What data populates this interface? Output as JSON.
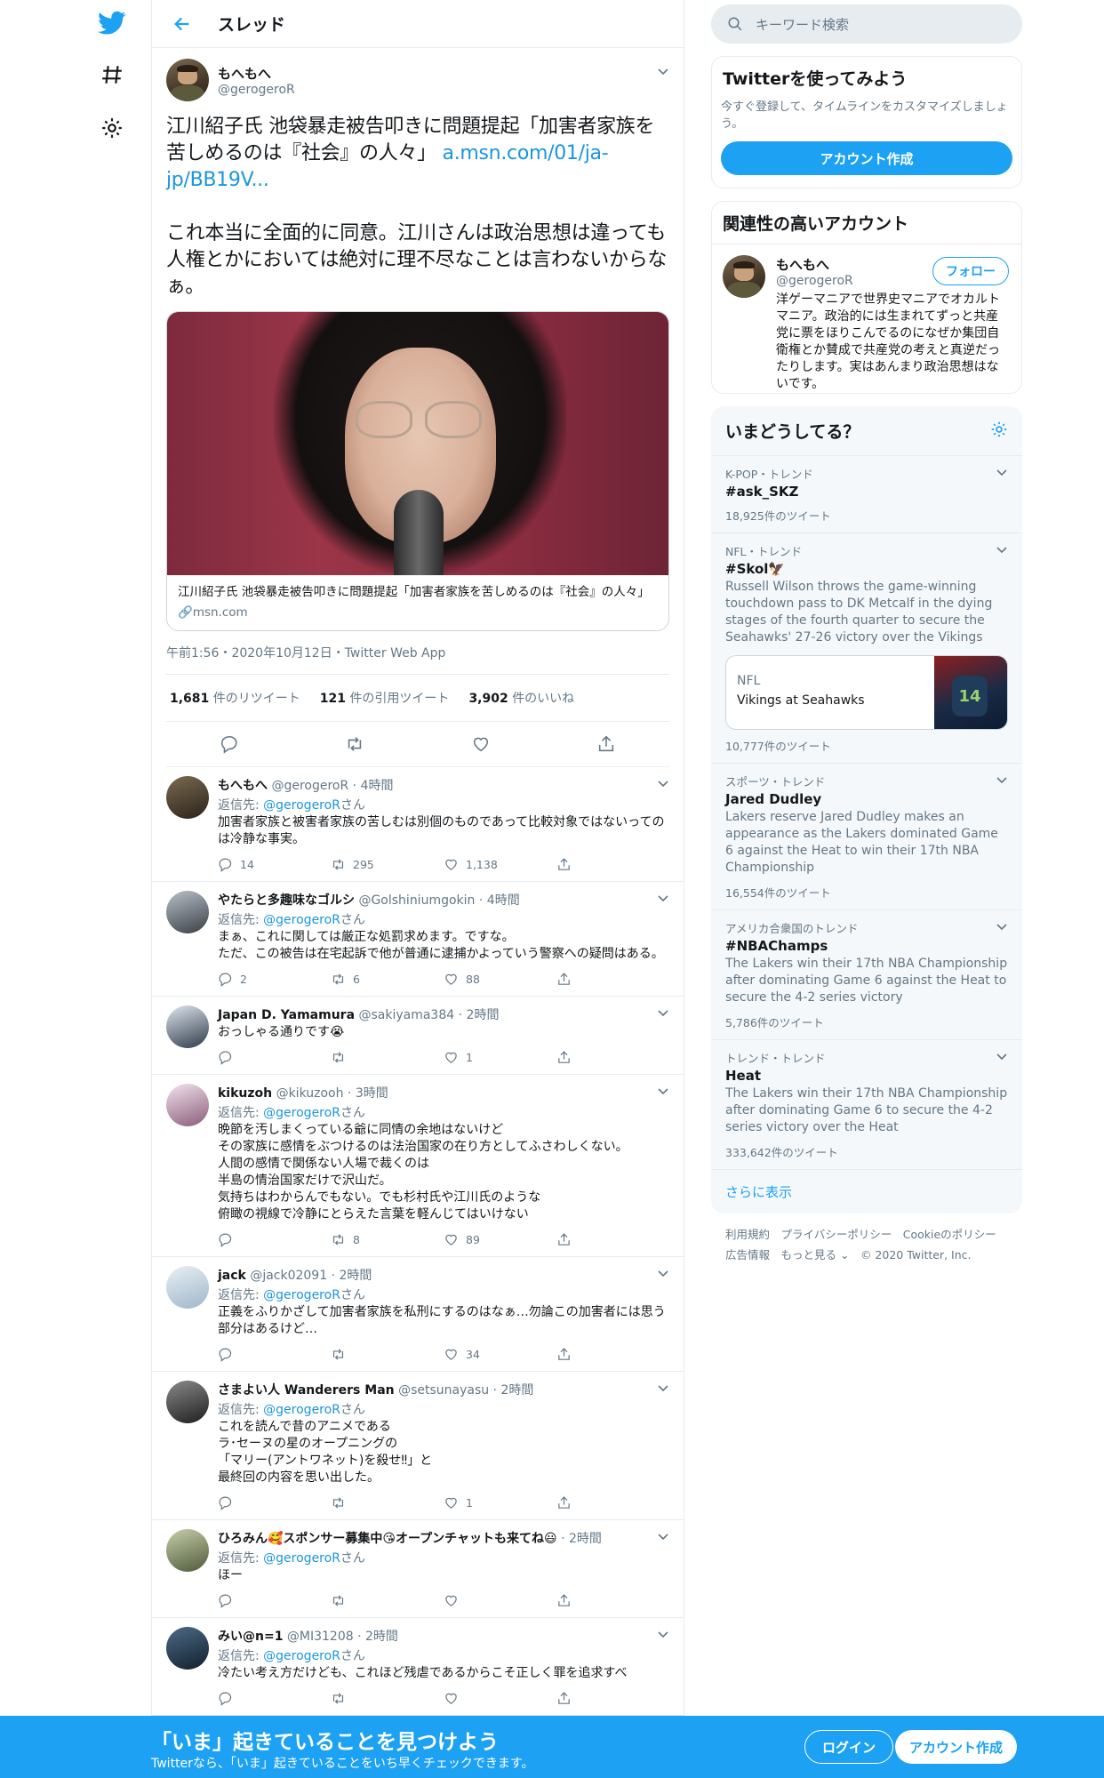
{
  "header": {
    "title": "スレッド"
  },
  "main_tweet": {
    "name": "もへもへ",
    "handle": "@gerogeroR",
    "text": "江川紹子氏 池袋暴走被告叩きに問題提起「加害者家族を苦しめるのは『社会』の人々」",
    "link": "a.msn.com/01/ja-jp/BB19V...",
    "text2": "これ本当に全面的に同意。江川さんは政治思想は違っても人権とかにおいては絶対に理不尽なことは言わないからなぁ。",
    "card_title": "江川紹子氏 池袋暴走被告叩きに問題提起「加害者家族を苦しめるのは『社会』の人々」",
    "card_source": "msn.com",
    "meta": "午前1:56・2020年10月12日・Twitter Web App",
    "retweets": "1,681",
    "retweets_label": "件のリツイート",
    "quotes": "121",
    "quotes_label": "件の引用ツイート",
    "likes": "3,902",
    "likes_label": "件のいいね"
  },
  "replies": [
    {
      "name": "もへもへ",
      "handle": "@gerogeroR",
      "time": "4時間",
      "to": "@gerogeroR",
      "text": "加害者家族と被害者家族の苦しむは別個のものであって比較対象ではないってのは冷静な事実。",
      "reply": "14",
      "rt": "295",
      "like": "1,138",
      "has_to": true
    },
    {
      "name": "やたらと多趣味なゴルシ",
      "handle": "@Golshiniumgokin",
      "time": "4時間",
      "to": "@gerogeroR",
      "text": "まぁ、これに関しては厳正な処罰求めます。ですな。\nただ、この被告は在宅起訴で他が普通に逮捕かよっていう警察への疑問はある。",
      "reply": "2",
      "rt": "6",
      "like": "88",
      "has_to": true
    },
    {
      "name": "Japan D. Yamamura",
      "handle": "@sakiyama384",
      "time": "2時間",
      "to": "",
      "text": "おっしゃる通りです😭",
      "reply": "",
      "rt": "",
      "like": "1",
      "has_to": false
    },
    {
      "name": "kikuzoh",
      "handle": "@kikuzooh",
      "time": "3時間",
      "to": "@gerogeroR",
      "text": "晩節を汚しまくっている爺に同情の余地はないけど\nその家族に感情をぶつけるのは法治国家の在り方としてふさわしくない。\n人間の感情で関係ない人場で裁くのは\n半島の情治国家だけで沢山だ。\n気持ちはわからんでもない。でも杉村氏や江川氏のような\n俯瞰の視線で冷静にとらえた言葉を軽んじてはいけない",
      "reply": "",
      "rt": "8",
      "like": "89",
      "has_to": true
    },
    {
      "name": "jack",
      "handle": "@jack02091",
      "time": "2時間",
      "to": "@gerogeroR",
      "text": "正義をふりかざして加害者家族を私刑にするのはなぁ…勿論この加害者には思う部分はあるけど…",
      "reply": "",
      "rt": "",
      "like": "34",
      "has_to": true
    },
    {
      "name": "さまよい人 Wanderers Man",
      "handle": "@setsunayasu",
      "time": "2時間",
      "to": "@gerogeroR",
      "text": "これを読んで昔のアニメである\nラ･セーヌの星のオープニングの\n「マリー(アントワネット)を殺せ‼」と\n最終回の内容を思い出した。",
      "reply": "",
      "rt": "",
      "like": "1",
      "has_to": true
    },
    {
      "name": "ひろみん🥰スポンサー募集中😘オープンチャットも来てね😃",
      "handle": "",
      "time": "2時間",
      "to": "@gerogeroR",
      "text": "ほー",
      "reply": "",
      "rt": "",
      "like": "",
      "has_to": true
    },
    {
      "name": "みい@n=1",
      "handle": "@MI31208",
      "time": "2時間",
      "to": "@gerogeroR",
      "text": "冷たい考え方だけども、これほど残虐であるからこそ正しく罪を追求すべ",
      "reply": "",
      "rt": "",
      "like": "",
      "has_to": true
    }
  ],
  "reply_to_label": "返信先:",
  "reply_to_suffix": "さん",
  "sidebar": {
    "search_placeholder": "キーワード検索",
    "signup_title": "Twitterを使ってみよう",
    "signup_desc": "今すぐ登録して、タイムラインをカスタマイズしましょう。",
    "signup_button": "アカウント作成",
    "related_title": "関連性の高いアカウント",
    "related_name": "もへもへ",
    "related_handle": "@gerogeroR",
    "follow": "フォロー",
    "related_bio": "洋ゲーマニアで世界史マニアでオカルトマニア。政治的には生まれてずっと共産党に票をほりこんでるのになぜか集団自衛権とか賛成で共産党の考えと真逆だったりします。実はあんまり政治思想はないです。",
    "trends_title": "いまどうしてる？",
    "trends": [
      {
        "cat": "K-POP・トレンド",
        "name": "#ask_SKZ",
        "desc": "",
        "count": "18,925件のツイート"
      },
      {
        "cat": "NFL・トレンド",
        "name": "#Skol🦅",
        "desc": "Russell Wilson throws the game-winning touchdown pass to DK Metcalf in the dying stages of the fourth quarter to secure the Seahawks' 27-26 victory over the Vikings",
        "count": "10,777件のツイート"
      },
      {
        "cat": "スポーツ・トレンド",
        "name": "Jared Dudley",
        "desc": "Lakers reserve Jared Dudley makes an appearance as the Lakers dominated Game 6 against the Heat to win their 17th NBA Championship",
        "count": "16,554件のツイート"
      },
      {
        "cat": "アメリカ合衆国のトレンド",
        "name": "#NBAChamps",
        "desc": "The Lakers win their 17th NBA Championship after dominating Game 6 against the Heat to secure the 4-2 series victory",
        "count": "5,786件のツイート"
      },
      {
        "cat": "トレンド・トレンド",
        "name": "Heat",
        "desc": "The Lakers win their 17th NBA Championship after dominating Game 6 to secure the 4-2 series victory over the Heat",
        "count": "333,642件のツイート"
      }
    ],
    "nfl_card_cat": "NFL",
    "nfl_card_title": "Vikings at Seahawks",
    "show_more": "さらに表示",
    "footer1": "利用規約　プライバシーポリシー　Cookieのポリシー",
    "footer2": "広告情報　もっと見る ⌄　© 2020 Twitter, Inc."
  },
  "bottom": {
    "title": "「いま」起きていることを見つけよう",
    "sub": "Twitterなら、「いま」起きていることをいち早くチェックできます。",
    "login": "ログイン",
    "signup": "アカウント作成"
  },
  "colors": {
    "accent": "#1da1f2",
    "link": "#1b95e0",
    "muted": "#657786"
  }
}
